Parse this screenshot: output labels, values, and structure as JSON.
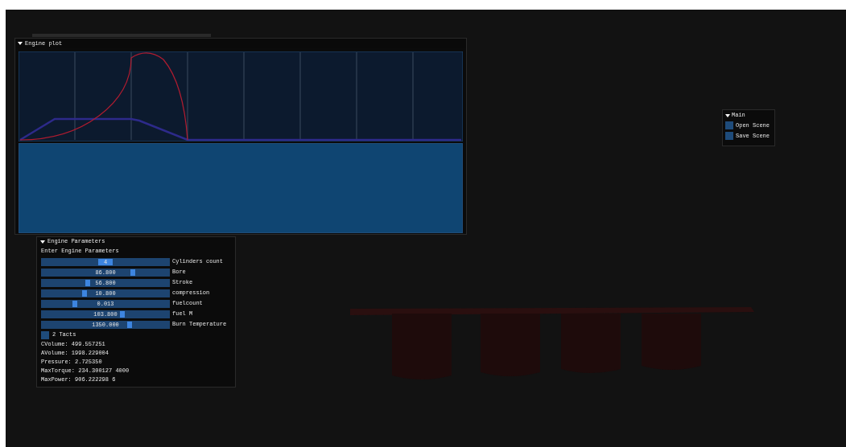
{
  "plot_window": {
    "title": "Engine plot",
    "expanded": true
  },
  "params_window": {
    "title": "Engine Parameters",
    "expanded": true,
    "heading": "Enter Engine Parameters",
    "sliders": [
      {
        "label": "Cylinders count",
        "value": "4",
        "level": 0.5,
        "kind": "int"
      },
      {
        "label": "Bore",
        "value": "86.800",
        "level": 0.71,
        "kind": "float"
      },
      {
        "label": "Stroke",
        "value": "56.800",
        "level": 0.36,
        "kind": "float"
      },
      {
        "label": "compression",
        "value": "10.800",
        "level": 0.34,
        "kind": "float"
      },
      {
        "label": "fuelcount",
        "value": "0.013",
        "level": 0.26,
        "kind": "float"
      },
      {
        "label": "fuel M",
        "value": "103.800",
        "level": 0.63,
        "kind": "float"
      },
      {
        "label": "Burn Temperature",
        "value": "1350.000",
        "level": 0.69,
        "kind": "float"
      }
    ],
    "checkbox": {
      "label": "2 Tacts",
      "checked": false
    },
    "readouts": [
      "CVolume: 499.557251",
      "AVolume: 1998.229004",
      "Pressure: 2.725350",
      "MaxTorque: 234.300127 4000",
      "MaxPower: 906.222298 6"
    ]
  },
  "main_window": {
    "title": "Main",
    "expanded": true,
    "items": [
      {
        "label": "Open Scene",
        "checked": false
      },
      {
        "label": "Save Scene",
        "checked": false
      }
    ]
  }
}
